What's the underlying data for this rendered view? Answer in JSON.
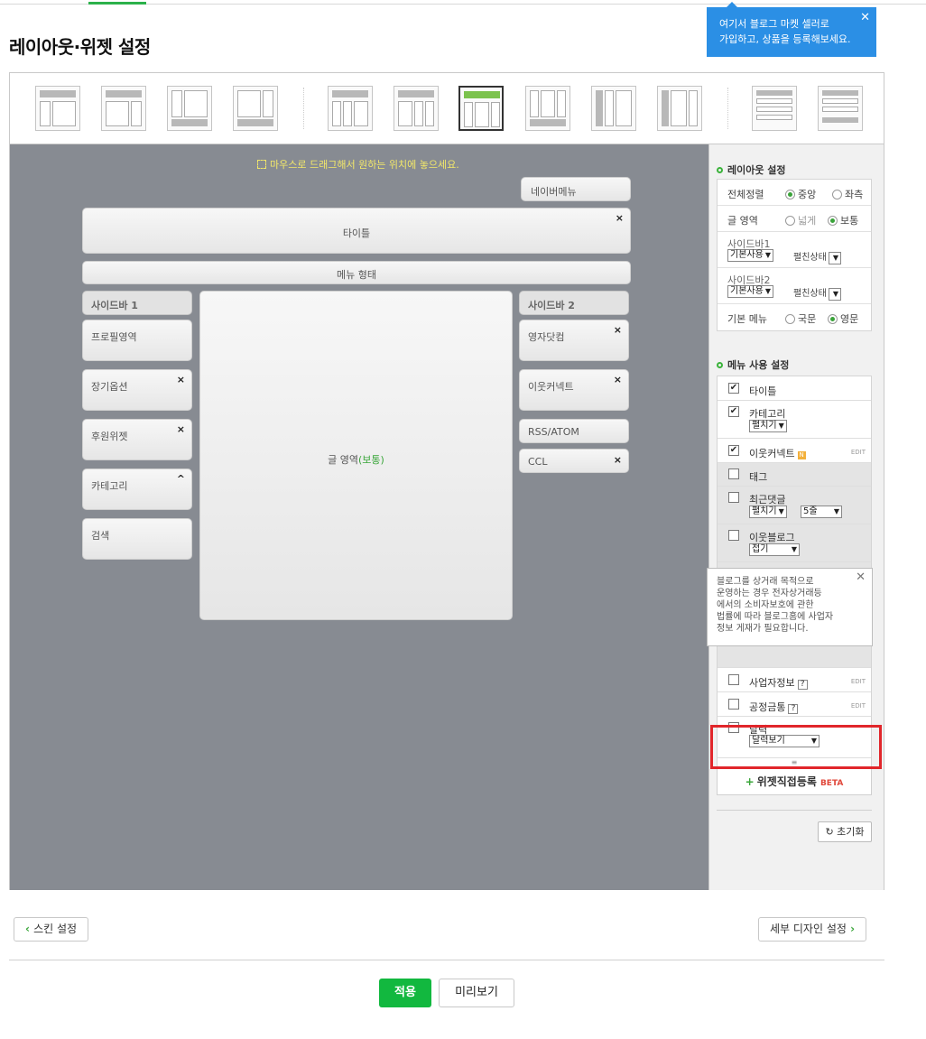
{
  "page_title": "레이아웃·위젯 설정",
  "notice": {
    "text_line1": "여기서 블로그 마켓 셀러로",
    "text_line2": "가입하고, 상품을 등록해보세요.",
    "close": "✕"
  },
  "canvas": {
    "hint": "마우스로 드래그해서 원하는 위치에 놓으세요.",
    "navermenu": "네이버메뉴",
    "title": "타이틀",
    "menu_form": "메뉴 형태",
    "sidebar1_header": "사이드바 1",
    "sidebar2_header": "사이드바 2",
    "sidebar1_items": [
      "프로필영역",
      "장기옵션",
      "후원위젯",
      "카테고리",
      "검색"
    ],
    "sidebar2_items": [
      "영자닷컴",
      "이웃커넥트",
      "RSS/ATOM",
      "CCL"
    ],
    "post_area": "글 영역",
    "post_area_mode": "(보통)"
  },
  "panel": {
    "layout_title": "레이아웃 설정",
    "align_label": "전체정렬",
    "align_center": "중앙",
    "align_left": "좌측",
    "post_area_label": "글 영역",
    "post_wide": "넓게",
    "post_normal": "보통",
    "sidebar1_label": "사이드바1",
    "sidebar1_select1": "기본사용",
    "sidebar1_select2": "펼친상태",
    "sidebar2_label": "사이드바2",
    "sidebar2_select1": "기본사용",
    "sidebar2_select2": "펼친상태",
    "basic_menu_label": "기본 메뉴",
    "menu_kor": "국문",
    "menu_eng": "영문",
    "menu_title": "메뉴 사용 설정",
    "menu_items": [
      {
        "label": "타이틀",
        "checked": "✔"
      },
      {
        "label": "카테고리",
        "checked": "✔",
        "select": "펼치기"
      },
      {
        "label": "이웃커넥트",
        "checked": "✔",
        "badge": "N",
        "edit": "EDIT"
      },
      {
        "label": "태그",
        "checked": ""
      },
      {
        "label": "최근댓글",
        "checked": "",
        "select": "펼치기",
        "select2": "5줄"
      },
      {
        "label": "이웃블로그",
        "checked": "",
        "select": "접기"
      },
      {
        "label": "사업자정보",
        "checked": "",
        "edit": "EDIT"
      },
      {
        "label": "공정금통",
        "checked": "",
        "edit": "EDIT"
      },
      {
        "label": "달력",
        "checked": "",
        "select": "달력보기"
      }
    ],
    "help_popup": [
      "블로그를 상거래 목적으로",
      "운영하는 경우 전자상거래등",
      "에서의 소비자보호에 관한",
      "법률에 따라 블로그홈에 사업자",
      "정보 게재가 필요합니다."
    ],
    "widget_register": "위젯직접등록",
    "beta": "BETA",
    "reset": "초기화"
  },
  "footer": {
    "skin_settings": "스킨 설정",
    "detail_design": "세부 디자인 설정",
    "apply": "적용",
    "preview": "미리보기"
  },
  "colors": {
    "accent_green": "#12b83f",
    "canvas_bg": "#878b92",
    "tooltip_blue": "#2b8fe5",
    "highlight_red": "#e1262b"
  }
}
